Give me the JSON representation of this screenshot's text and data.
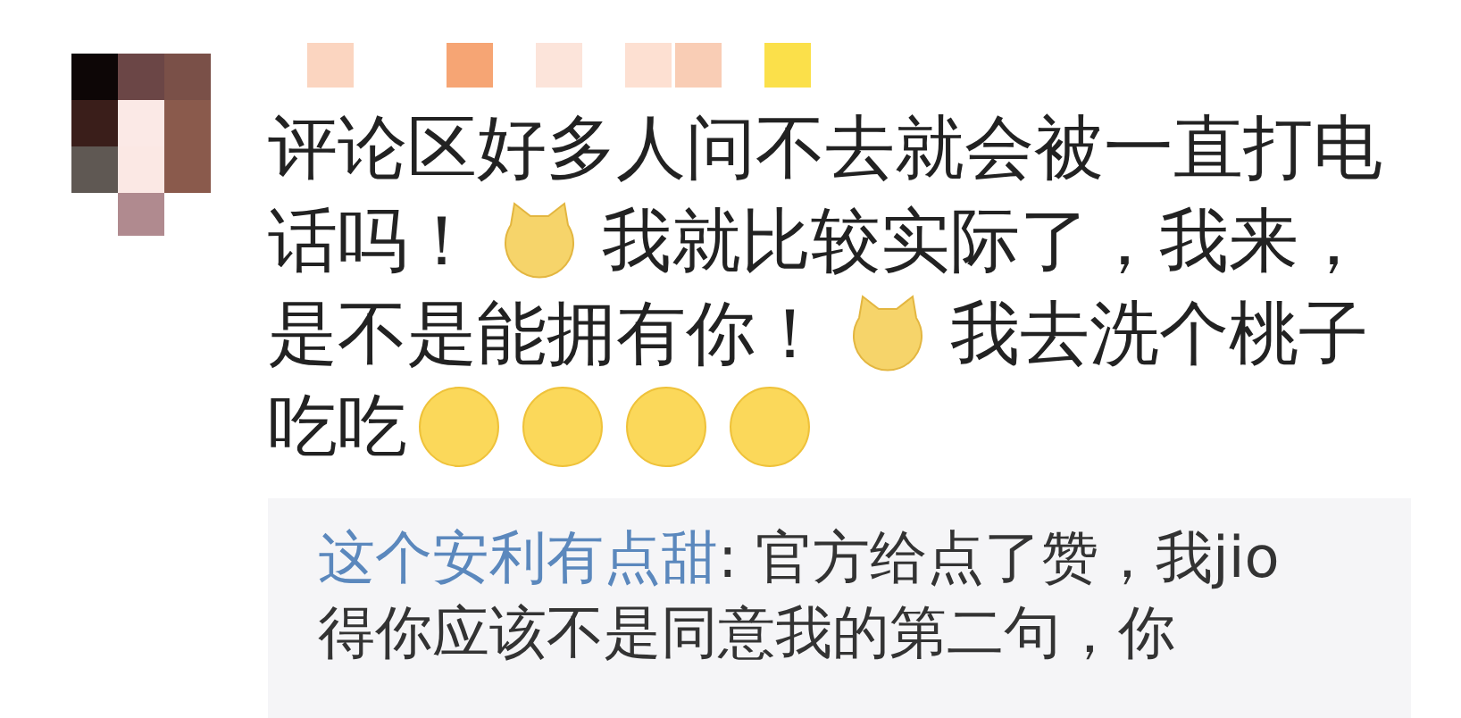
{
  "comment": {
    "lines": [
      [
        {
          "kind": "text",
          "text": "评论区好多人问不去就会被一直打电"
        }
      ],
      [
        {
          "kind": "text",
          "text": "话吗！"
        },
        {
          "kind": "dog"
        },
        {
          "kind": "text",
          "text": "我就比较实际了，我来，"
        }
      ],
      [
        {
          "kind": "text",
          "text": "是不是能拥有你！"
        },
        {
          "kind": "dog"
        },
        {
          "kind": "text",
          "text": "我去洗个桃子"
        }
      ],
      [
        {
          "kind": "text",
          "text": "吃吃"
        },
        {
          "kind": "pleading"
        },
        {
          "kind": "pleading"
        },
        {
          "kind": "pleading"
        },
        {
          "kind": "pleading"
        }
      ]
    ]
  },
  "reply": {
    "author": "这个安利有点甜",
    "text": ": 官方给点了赞，我jio得你应该不是同意我的第二句，你"
  }
}
